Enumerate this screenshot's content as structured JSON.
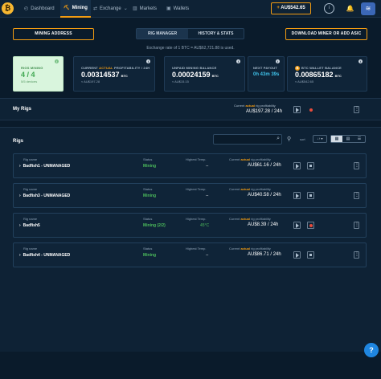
{
  "app": {
    "logo_glyph": "₿",
    "nav": [
      {
        "icon": "dashboard-icon",
        "glyph": "◴",
        "label": "Dashboard"
      },
      {
        "icon": "pickaxe-icon",
        "glyph": "⛏",
        "label": "Mining"
      },
      {
        "icon": "exchange-icon",
        "glyph": "⇄",
        "label": "Exchange",
        "caret": "⌄"
      },
      {
        "icon": "markets-icon",
        "glyph": "▥",
        "label": "Markets"
      },
      {
        "icon": "wallet-icon",
        "glyph": "▣",
        "label": "Wallets"
      }
    ],
    "balance": {
      "plus": "+",
      "amount": "AU$542.65"
    },
    "info_glyph": "i",
    "bell_glyph": "🔔",
    "avatar_glyph": "≋"
  },
  "actions": {
    "mining_address": "MINING ADDRESS",
    "download": "DOWNLOAD MINER OR ADD ASIC",
    "tabs": [
      "RIG MANAGER",
      "HISTORY & STATS"
    ]
  },
  "exchange_note": "Exchange rate of 1 BTC = AU$62,721.88 is used.",
  "stats": {
    "rigs_mining": {
      "label": "RIGS MINING",
      "value": "4 / 4",
      "sub": "5/5 devices"
    },
    "profitability": {
      "label_pre": "CURRENT ",
      "label_hl": "ACTUAL",
      "label_post": " PROFITABILITY / 24H",
      "value": "0.00314537",
      "unit": "BTC",
      "sub": "≈ AU$197.28"
    },
    "unpaid": {
      "label": "UNPAID MINING BALANCE",
      "value": "0.00024159",
      "unit": "BTC",
      "sub": "≈ AU$15.15"
    },
    "payout": {
      "label": "NEXT PAYOUT",
      "value": "0h 43m 39s"
    },
    "wallet": {
      "label": "BTC WALLET BALANCE",
      "btc_glyph": "₿",
      "value": "0.00865182",
      "unit": "BTC",
      "sub": "≈ AU$542.65"
    }
  },
  "my_rigs": {
    "title": "My Rigs",
    "profit_pre": "Current ",
    "profit_hl": "actual",
    "profit_post": " rig profitability",
    "profit_value": "AU$197.28 / 24h"
  },
  "rigs_section": {
    "title": "Rigs",
    "search_placeholder": "",
    "search_glyph": "⌕",
    "filter_glyph": "⚲",
    "sort_label": "sort",
    "sort_value": "↓↑ ▾",
    "view_glyphs": [
      "▦",
      "▤",
      "☰"
    ]
  },
  "rig_labels": {
    "name": "Rig name",
    "status": "Status",
    "temp": "Highest Temp.",
    "profit_pre": "Current ",
    "profit_hl": "actual",
    "profit_post": " rig profitability"
  },
  "rigs": [
    {
      "name": "Badfish1 - UNMANAGED",
      "status": "Mining",
      "temp": "--",
      "profit": "AU$61.16 / 24h",
      "managed": false
    },
    {
      "name": "Badfish3 - UNMANAGED",
      "status": "Mining",
      "temp": "--",
      "profit": "AU$40.58 / 24h",
      "managed": false
    },
    {
      "name": "Badfish5",
      "status": "Mining (2/2)",
      "temp": "45°C",
      "profit": "AU$8.39 / 24h",
      "managed": true
    },
    {
      "name": "Badfish4 - UNMANAGED",
      "status": "Mining",
      "temp": "--",
      "profit": "AU$86.71 / 24h",
      "managed": false
    }
  ],
  "chevron_glyph": "›",
  "kebab_glyph": "⋮",
  "help_glyph": "?"
}
